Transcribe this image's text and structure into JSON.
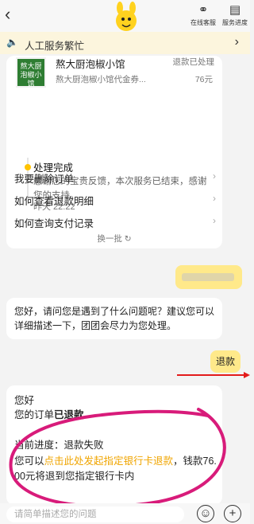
{
  "header": {
    "service_label": "在线客服",
    "progress_label": "服务进度"
  },
  "notice": {
    "text": "人工服务繁忙"
  },
  "order": {
    "shop_logo_text": "熬大厨泡椒小馆",
    "shop_name": "熬大厨泡椒小馆",
    "item": "熬大厨泡椒小馆代金券...",
    "status": "退款已处理",
    "price": "76元"
  },
  "progress": {
    "title": "处理完成",
    "desc": "感谢您的宝贵反馈，本次服务已结束，感谢您的支持。",
    "time": "昨天 22:22"
  },
  "faq": [
    {
      "label": "我要删除订单"
    },
    {
      "label": "如何查看退款明细"
    },
    {
      "label": "如何查询支付记录"
    }
  ],
  "refresh_label": "换一批",
  "messages": {
    "bot_question": "您好，请问您是遇到了什么问题呢？建议您可以详细描述一下，团团会尽力为您处理。",
    "user_refund": "退款",
    "reply_greeting": "您好",
    "reply_order_prefix": "您的订单",
    "reply_order_status": "已退款",
    "reply_progress": "当前进度：退款失败",
    "reply_hint_prefix": "您可以",
    "reply_hint_link": "点击此处发起指定银行卡退款",
    "reply_hint_suffix": "，钱款76.",
    "reply_hint_line2": "00元将退到您指定银行卡内"
  },
  "input": {
    "placeholder": "请简单描述您的问题"
  },
  "colors": {
    "accent": "#ffc300",
    "link": "#f0a500",
    "annotation_pink": "#d81b7a",
    "annotation_red": "#e31b1b"
  }
}
